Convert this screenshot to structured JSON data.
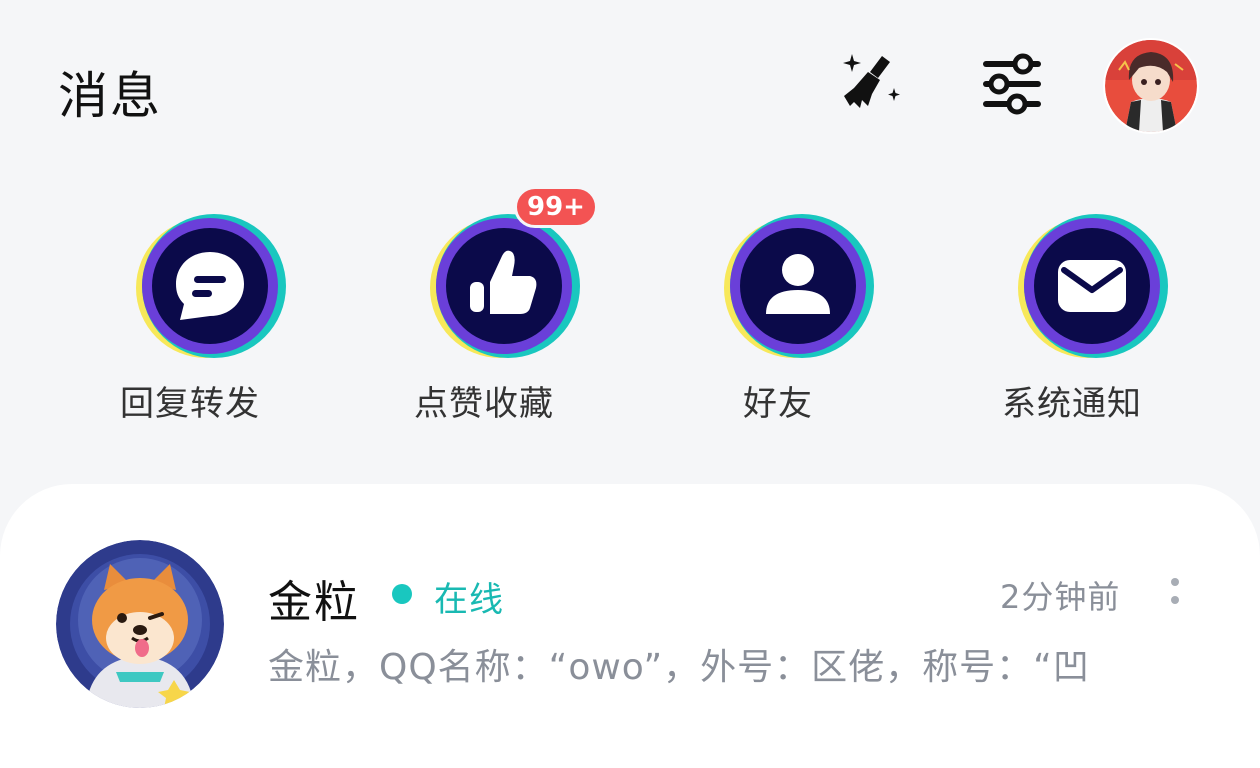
{
  "header": {
    "title": "消息",
    "clean_icon": "broom-sparkle-icon",
    "filter_icon": "sliders-icon"
  },
  "categories": [
    {
      "label": "回复转发",
      "icon": "chat-bubble-icon"
    },
    {
      "label": "点赞收藏",
      "icon": "thumbs-up-icon",
      "badge": "99+"
    },
    {
      "label": "好友",
      "icon": "person-icon"
    },
    {
      "label": "系统通知",
      "icon": "envelope-icon"
    }
  ],
  "colors": {
    "accent_teal": "#19c7bf",
    "ring_purple": "#6a3fd9",
    "ring_navy": "#0b0a4a",
    "ring_yellow": "#f7e85a",
    "badge_red": "#f35353"
  },
  "conversations": [
    {
      "name": "金粒",
      "status": "在线",
      "time": "2分钟前",
      "preview": "金粒，QQ名称：“owo”，外号：区佬，称号：“凹"
    }
  ]
}
